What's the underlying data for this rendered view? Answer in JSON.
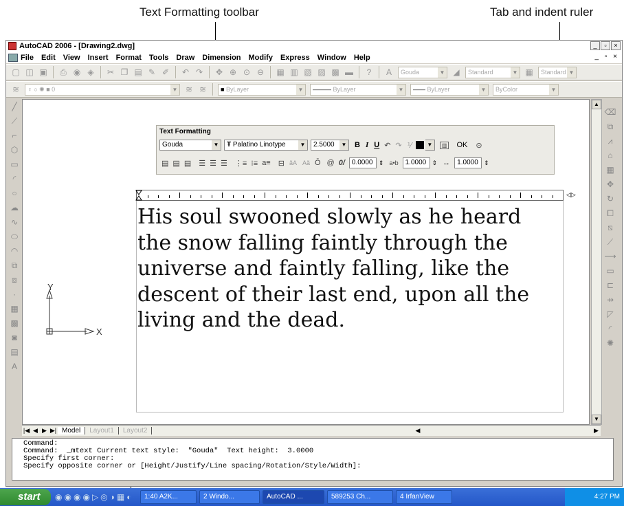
{
  "callouts": {
    "text_formatting_toolbar": "Text Formatting toolbar",
    "tab_indent_ruler": "Tab and indent ruler"
  },
  "window": {
    "title": "AutoCAD 2006 - [Drawing2.dwg]"
  },
  "menu": [
    "File",
    "Edit",
    "View",
    "Insert",
    "Format",
    "Tools",
    "Draw",
    "Dimension",
    "Modify",
    "Express",
    "Window",
    "Help"
  ],
  "toolbar": {
    "text_style": "Gouda",
    "dim_style": "Standard",
    "table_style": "Standard",
    "layer": "0",
    "color": "ByLayer",
    "linetype": "ByLayer",
    "lineweight": "ByLayer",
    "plotstyle": "ByColor"
  },
  "text_formatting": {
    "title": "Text Formatting",
    "style": "Gouda",
    "font": "Palatino Linotype",
    "height": "2.5000",
    "bold": "B",
    "italic": "I",
    "underline": "U",
    "ok": "OK",
    "oblique": "0.0000",
    "tracking": "1.0000",
    "width_factor": "1.0000"
  },
  "mtext": {
    "line1": "His soul swooned slowly as he heard",
    "line2": "the snow falling faintly through the",
    "line3": "universe and faintly falling, like the",
    "line4": "descent of their last end, upon all the",
    "line5": "living and the dead."
  },
  "ucs": {
    "x": "X",
    "y": "Y"
  },
  "tabs": [
    "Model",
    "Layout1",
    "Layout2"
  ],
  "command": {
    "line1": "Command:",
    "line2": "Command:  _mtext Current text style:  \"Gouda\"  Text height:  3.0000",
    "line3": "Specify first corner:",
    "line4": "Specify opposite corner or [Height/Justify/Line spacing/Rotation/Style/Width]:"
  },
  "taskbar": {
    "start": "start",
    "buttons": [
      "1:40 A2K...",
      "2 Windo...",
      "AutoCAD ...",
      "589253 Ch...",
      "4 IrfanView"
    ],
    "clock": "4:27 PM"
  }
}
